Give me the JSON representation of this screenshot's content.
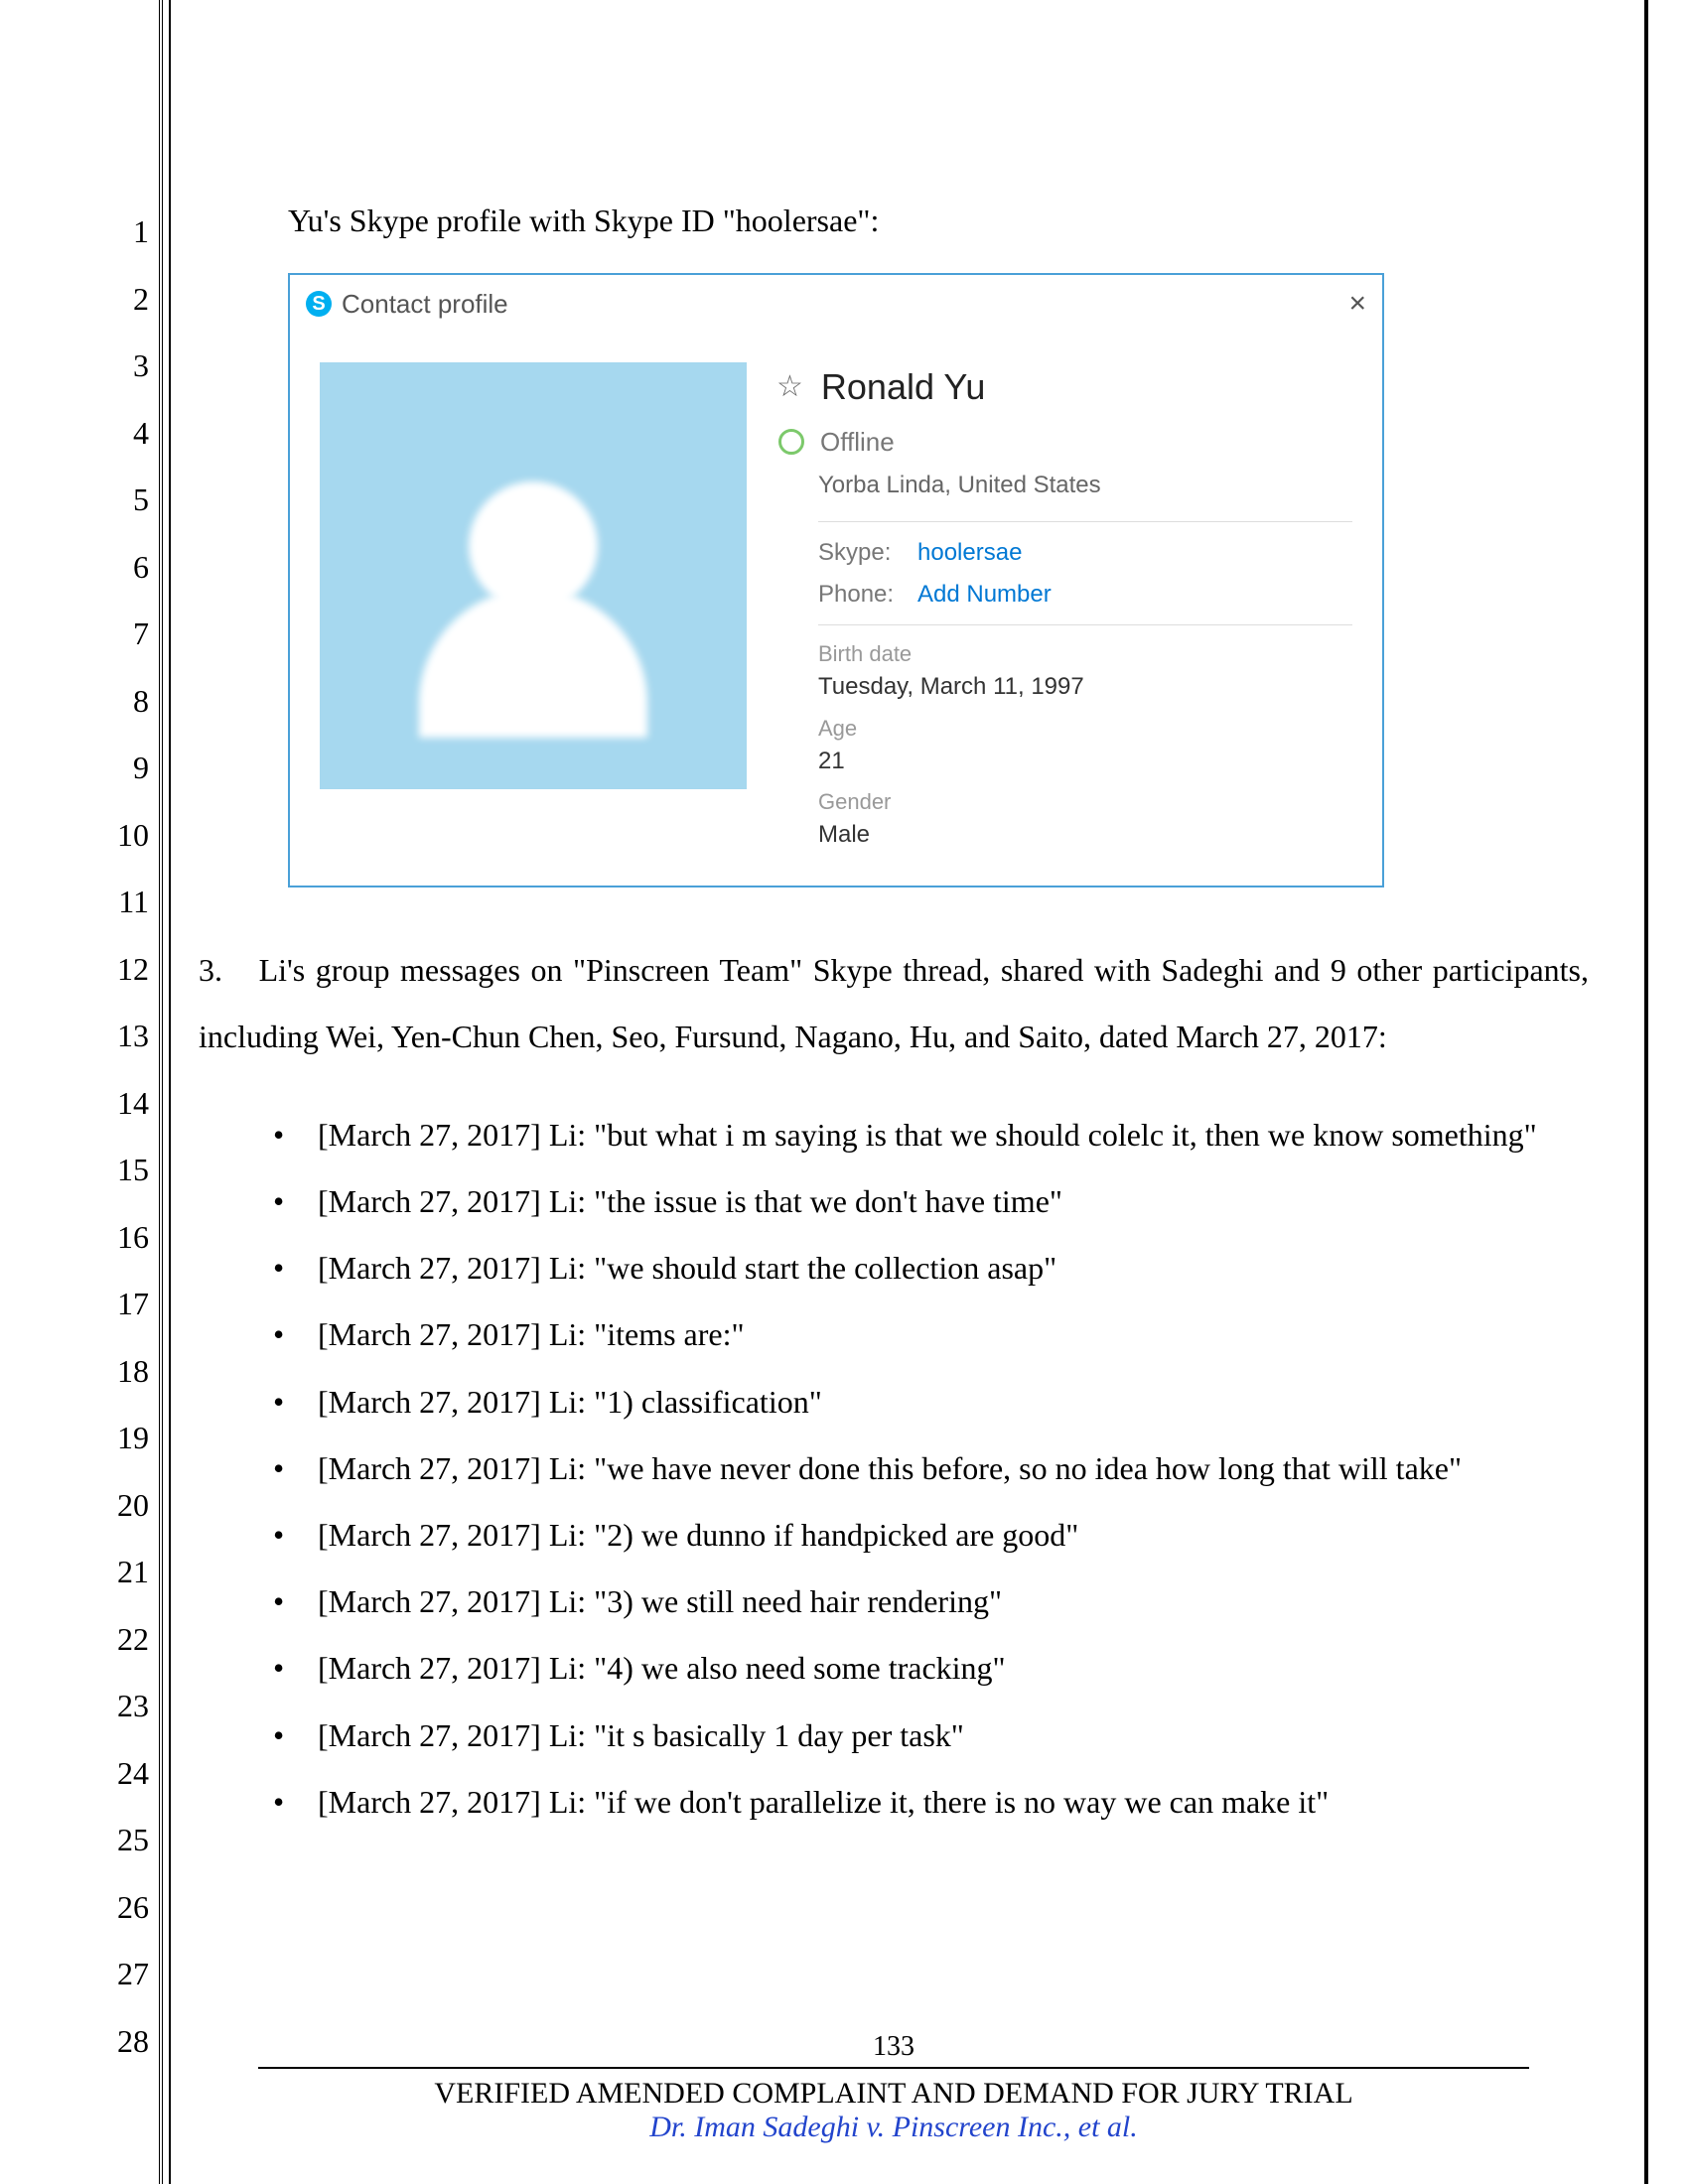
{
  "line_numbers": [
    "1",
    "2",
    "3",
    "4",
    "5",
    "6",
    "7",
    "8",
    "9",
    "10",
    "11",
    "12",
    "13",
    "14",
    "15",
    "16",
    "17",
    "18",
    "19",
    "20",
    "21",
    "22",
    "23",
    "24",
    "25",
    "26",
    "27",
    "28"
  ],
  "intro": "Yu's Skype profile with Skype ID \"hoolersae\":",
  "skype": {
    "header_title": "Contact profile",
    "close": "×",
    "name": "Ronald Yu",
    "status": "Offline",
    "location": "Yorba Linda, United States",
    "rows": {
      "skype_label": "Skype:",
      "skype_value": "hoolersae",
      "phone_label": "Phone:",
      "phone_value": "Add Number"
    },
    "birth_label": "Birth date",
    "birth_value": "Tuesday, March 11, 1997",
    "age_label": "Age",
    "age_value": "21",
    "gender_label": "Gender",
    "gender_value": "Male"
  },
  "para3_num": "3.",
  "para3_text": "Li's group messages on \"Pinscreen Team\" Skype thread, shared with Sadeghi and 9 other participants, including Wei, Yen-Chun Chen, Seo, Fursund, Nagano, Hu, and Saito, dated March 27, 2017:",
  "bullets": [
    "[March 27, 2017] Li: \"but what i m saying is that we should colelc it, then we know something\"",
    "[March 27, 2017] Li: \"the issue is that we don't have time\"",
    "[March 27, 2017] Li: \"we should start the collection asap\"",
    "[March 27, 2017] Li: \"items are:\"",
    "[March 27, 2017] Li: \"1) classification\"",
    "[March 27, 2017] Li: \"we have never done this before, so no idea how long that will take\"",
    "[March 27, 2017] Li: \"2) we dunno if handpicked are good\"",
    "[March 27, 2017] Li: \"3) we still need hair rendering\"",
    "[March 27, 2017] Li: \"4) we also need some tracking\"",
    "[March 27, 2017] Li: \"it s basically 1 day per task\"",
    "[March 27, 2017] Li: \"if we don't parallelize it, there is no way we can make it\""
  ],
  "footer": {
    "page": "133",
    "title": "VERIFIED AMENDED COMPLAINT AND DEMAND FOR JURY TRIAL",
    "case": "Dr. Iman Sadeghi v. Pinscreen Inc., et al."
  }
}
